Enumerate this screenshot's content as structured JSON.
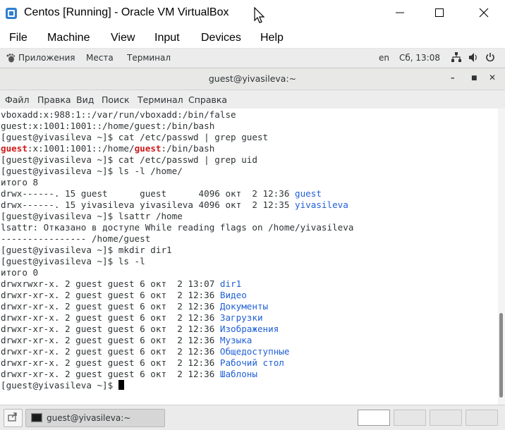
{
  "window": {
    "title": "Centos [Running] - Oracle VM VirtualBox"
  },
  "vbox_menu": [
    "File",
    "Machine",
    "View",
    "Input",
    "Devices",
    "Help"
  ],
  "gnome_panel": {
    "applications": "Приложения",
    "places": "Места",
    "terminal": "Терминал",
    "keyboard_layout": "en",
    "clock": "Сб, 13:08"
  },
  "terminal": {
    "title": "guest@yivasileva:~",
    "menu": [
      "Файл",
      "Правка",
      "Вид",
      "Поиск",
      "Терминал",
      "Справка"
    ],
    "lines": [
      [
        {
          "t": "vboxadd:x:988:1::/var/run/vboxadd:/bin/false"
        }
      ],
      [
        {
          "t": "guest:x:1001:1001::/home/guest:/bin/bash"
        }
      ],
      [
        {
          "t": "[guest@yivasileva ~]$ cat /etc/passwd | grep guest"
        }
      ],
      [
        {
          "t": "guest",
          "c": "red"
        },
        {
          "t": ":x:1001:1001::/home/"
        },
        {
          "t": "guest",
          "c": "red"
        },
        {
          "t": ":/bin/bash"
        }
      ],
      [
        {
          "t": "[guest@yivasileva ~]$ cat /etc/passwd | grep uid"
        }
      ],
      [
        {
          "t": "[guest@yivasileva ~]$ ls -l /home/"
        }
      ],
      [
        {
          "t": "итого 8"
        }
      ],
      [
        {
          "t": "drwx------. 15 guest      guest      4096 окт  2 12:36 "
        },
        {
          "t": "guest",
          "c": "blue"
        }
      ],
      [
        {
          "t": "drwx------. 15 yivasileva yivasileva 4096 окт  2 12:35 "
        },
        {
          "t": "yivasileva",
          "c": "blue"
        }
      ],
      [
        {
          "t": "[guest@yivasileva ~]$ lsattr /home"
        }
      ],
      [
        {
          "t": "lsattr: Отказано в доступе While reading flags on /home/yivasileva"
        }
      ],
      [
        {
          "t": "---------------- /home/guest"
        }
      ],
      [
        {
          "t": "[guest@yivasileva ~]$ mkdir dir1"
        }
      ],
      [
        {
          "t": "[guest@yivasileva ~]$ ls -l"
        }
      ],
      [
        {
          "t": "итого 0"
        }
      ],
      [
        {
          "t": "drwxrwxr-x. 2 guest guest 6 окт  2 13:07 "
        },
        {
          "t": "dir1",
          "c": "blue"
        }
      ],
      [
        {
          "t": "drwxr-xr-x. 2 guest guest 6 окт  2 12:36 "
        },
        {
          "t": "Видео",
          "c": "blue"
        }
      ],
      [
        {
          "t": "drwxr-xr-x. 2 guest guest 6 окт  2 12:36 "
        },
        {
          "t": "Документы",
          "c": "blue"
        }
      ],
      [
        {
          "t": "drwxr-xr-x. 2 guest guest 6 окт  2 12:36 "
        },
        {
          "t": "Загрузки",
          "c": "blue"
        }
      ],
      [
        {
          "t": "drwxr-xr-x. 2 guest guest 6 окт  2 12:36 "
        },
        {
          "t": "Изображения",
          "c": "blue"
        }
      ],
      [
        {
          "t": "drwxr-xr-x. 2 guest guest 6 окт  2 12:36 "
        },
        {
          "t": "Музыка",
          "c": "blue"
        }
      ],
      [
        {
          "t": "drwxr-xr-x. 2 guest guest 6 окт  2 12:36 "
        },
        {
          "t": "Общедоступные",
          "c": "blue"
        }
      ],
      [
        {
          "t": "drwxr-xr-x. 2 guest guest 6 окт  2 12:36 "
        },
        {
          "t": "Рабочий стол",
          "c": "blue"
        }
      ],
      [
        {
          "t": "drwxr-xr-x. 2 guest guest 6 окт  2 12:36 "
        },
        {
          "t": "Шаблоны",
          "c": "blue"
        }
      ],
      [
        {
          "t": "[guest@yivasileva ~]$ "
        }
      ]
    ]
  },
  "taskbar": {
    "task_label": "guest@yivasileva:~"
  },
  "colors": {
    "link_blue": "#1f5fd6",
    "match_red": "#cc1c1c",
    "text": "#2e3436"
  },
  "icons": [
    "virtualbox-app-icon",
    "minimize-icon",
    "maximize-icon",
    "close-icon",
    "mouse-pointer-icon",
    "gnome-foot-icon",
    "network-icon",
    "volume-icon",
    "power-icon",
    "terminal-icon",
    "show-desktop-icon"
  ]
}
